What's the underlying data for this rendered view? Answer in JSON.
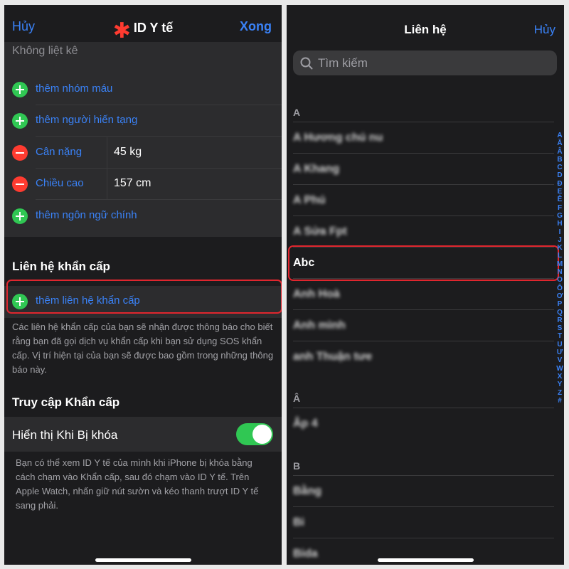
{
  "left": {
    "nav": {
      "cancel": "Hủy",
      "title": "ID Y tế",
      "done": "Xong"
    },
    "unlisted": "Không liệt kê",
    "rows": [
      {
        "type": "add",
        "label": "thêm nhóm máu"
      },
      {
        "type": "add",
        "label": "thêm người hiến tạng"
      },
      {
        "type": "remove",
        "label": "Cân nặng",
        "value": "45 kg"
      },
      {
        "type": "remove",
        "label": "Chiều cao",
        "value": "157 cm"
      },
      {
        "type": "add",
        "label": "thêm ngôn ngữ chính"
      }
    ],
    "emergency_section_title": "Liên hệ khẩn cấp",
    "add_emergency_contact": "thêm liên hệ khẩn cấp",
    "emergency_footnote": "Các liên hệ khẩn cấp của bạn sẽ nhận được thông báo cho biết rằng bạn đã gọi dịch vụ khẩn cấp khi bạn sử dụng SOS khẩn cấp. Vị trí hiện tại của bạn sẽ được bao gồm trong những thông báo này.",
    "access_section_title": "Truy cập Khẩn cấp",
    "show_when_locked": "Hiển thị Khi Bị khóa",
    "show_when_locked_on": true,
    "access_footnote": "Bạn có thể xem ID Y tế của mình khi iPhone bị khóa bằng cách chạm vào Khẩn cấp, sau đó chạm vào ID Y tế. Trên Apple Watch, nhấn giữ nút sườn và kéo thanh trượt ID Y tế sang phải."
  },
  "right": {
    "title": "Liên hệ",
    "cancel": "Hủy",
    "search_placeholder": "Tìm kiếm",
    "sections": [
      {
        "letter": "A",
        "contacts": [
          "A Hương chú nu",
          "A Khang",
          "A Phú",
          "A Sửa Fpt",
          "Abc",
          "Anh Hoà",
          "Anh mình",
          "anh Thuận tưe"
        ]
      },
      {
        "letter": "Â",
        "contacts": [
          "Âp 4"
        ]
      },
      {
        "letter": "B",
        "contacts": [
          "Bằng",
          "Bi",
          "Bida"
        ]
      }
    ],
    "highlighted_contact": "Abc",
    "index_letters": [
      "A",
      "Ă",
      "Â",
      "B",
      "C",
      "D",
      "Đ",
      "E",
      "Ê",
      "F",
      "G",
      "H",
      "I",
      "J",
      "K",
      "L",
      "M",
      "N",
      "O",
      "Ô",
      "Ơ",
      "P",
      "Q",
      "R",
      "S",
      "T",
      "U",
      "Ư",
      "V",
      "W",
      "X",
      "Y",
      "Z",
      "#"
    ]
  },
  "colors": {
    "accent": "#3a82f7",
    "add": "#30c753",
    "remove": "#ff3b30",
    "highlight": "#e0262e"
  }
}
